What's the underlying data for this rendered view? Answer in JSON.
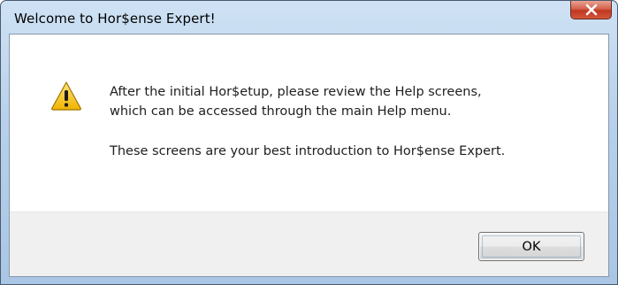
{
  "window": {
    "title": "Welcome to Hor$ense Expert!"
  },
  "icons": {
    "close": "close-icon",
    "warning": "warning-icon"
  },
  "message": {
    "line1": "After the initial Hor$etup, please review the Help screens,",
    "line2": "which can be accessed through the main Help menu.",
    "line3": "These screens are your best introduction to Hor$ense Expert."
  },
  "buttons": {
    "ok_label": "OK"
  },
  "colors": {
    "titlebar": "#b9d1ea",
    "close_button": "#c1371f",
    "footer": "#f0f0f0",
    "warning_yellow": "#f5c518"
  }
}
